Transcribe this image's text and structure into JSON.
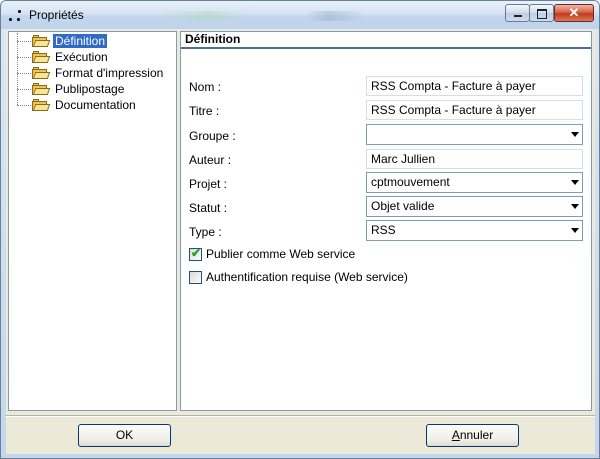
{
  "window": {
    "title": "Propriétés",
    "icon": "app-icon",
    "controls": {
      "minimize": "minimize-icon",
      "maximize": "maximize-icon",
      "close": "close-icon",
      "close_glyph": "✕"
    }
  },
  "tree": {
    "items": [
      {
        "label": "Définition",
        "selected": true
      },
      {
        "label": "Exécution"
      },
      {
        "label": "Format d'impression"
      },
      {
        "label": "Publipostage"
      },
      {
        "label": "Documentation"
      }
    ]
  },
  "panel": {
    "title": "Définition",
    "fields": {
      "nom": {
        "label": "Nom :",
        "value": "RSS Compta - Facture à payer"
      },
      "titre": {
        "label": "Titre :",
        "value": "RSS Compta - Facture à payer"
      },
      "groupe": {
        "label": "Groupe :",
        "value": ""
      },
      "auteur": {
        "label": "Auteur :",
        "value": "Marc Jullien"
      },
      "projet": {
        "label": "Projet :",
        "value": "cptmouvement"
      },
      "statut": {
        "label": "Statut :",
        "value": "Objet valide"
      },
      "type": {
        "label": "Type :",
        "value": "RSS"
      }
    },
    "checkboxes": {
      "webservice": {
        "label": "Publier comme Web service",
        "checked": true,
        "mark": "✔"
      },
      "auth": {
        "label": "Authentification requise (Web service)",
        "checked": false
      }
    }
  },
  "buttons": {
    "ok": "OK",
    "cancel_first": "A",
    "cancel_rest": "nnuler"
  },
  "colors": {
    "selection": "#316ac5",
    "dialog_bg": "#ece9d8",
    "header_rule": "#4f6f8f"
  }
}
